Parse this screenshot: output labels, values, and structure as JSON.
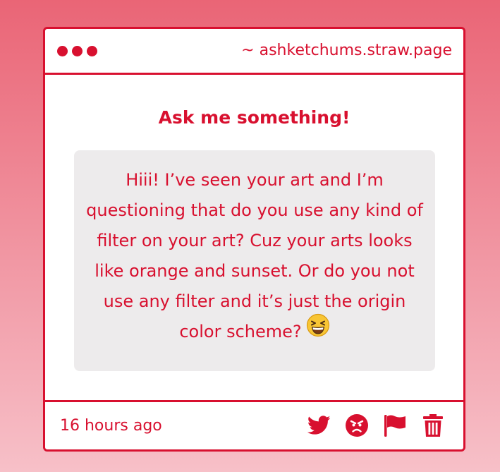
{
  "window": {
    "url": "~ ashketchums.straw.page"
  },
  "content": {
    "heading": "Ask me something!",
    "question": "Hiii! I’ve seen your art and I’m questioning that do you use any kind of filter on your art? Cuz your arts looks like orange and sunset. Or do you not use any filter and it’s just the origin color scheme?",
    "question_emoji": "grinning-squinting-face-emoji"
  },
  "footer": {
    "time": "16 hours ago",
    "actions": [
      "twitter-icon",
      "angry-face-icon",
      "flag-icon",
      "trash-icon"
    ]
  },
  "colors": {
    "accent": "#d8102f",
    "bubble": "#edebec",
    "background_top": "#ea6576",
    "background_bottom": "#f7c0c8"
  }
}
